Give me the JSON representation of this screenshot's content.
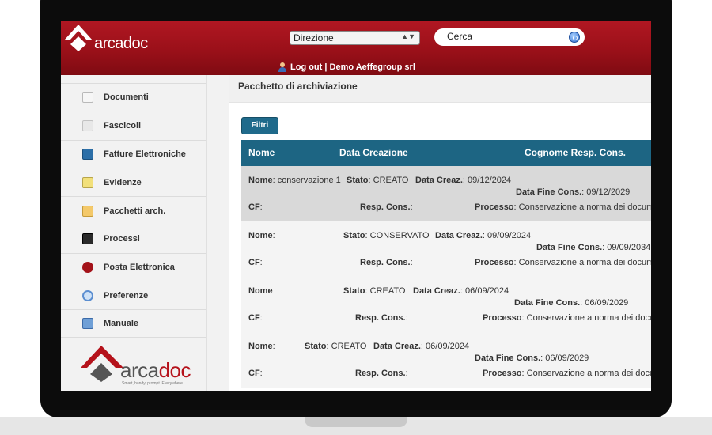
{
  "header": {
    "logo_text": "arcadoc",
    "selector_value": "Direzione",
    "search_value": "Cerca",
    "logout_text": "Log out | Demo Aeffegroup srl"
  },
  "sidebar": {
    "items": [
      {
        "label": "Documenti",
        "icon": "document-icon"
      },
      {
        "label": "Fascicoli",
        "icon": "folders-icon"
      },
      {
        "label": "Fatture Elettroniche",
        "icon": "invoice-icon"
      },
      {
        "label": "Evidenze",
        "icon": "highlight-icon"
      },
      {
        "label": "Pacchetti arch.",
        "icon": "package-icon"
      },
      {
        "label": "Processi",
        "icon": "process-icon"
      },
      {
        "label": "Posta Elettronica",
        "icon": "mail-icon"
      },
      {
        "label": "Preferenze",
        "icon": "preferences-icon"
      },
      {
        "label": "Manuale",
        "icon": "manual-icon"
      }
    ],
    "logo_text_gray": "arca",
    "logo_text_red": "doc",
    "tagline": "Smart, handy, prompt. Everywhere"
  },
  "main": {
    "page_title": "Pacchetto di archiviazione",
    "filter_button": "Filtri",
    "columns": [
      "Nome",
      "Data Creazione",
      "Cognome Resp. Cons."
    ],
    "labels": {
      "nome": "Nome",
      "stato": "Stato",
      "data_creaz": "Data Creaz.",
      "data_fine": "Data Fine Cons.",
      "cf": "CF",
      "resp": "Resp. Cons.",
      "processo": "Processo"
    },
    "rows": [
      {
        "nome": "conservazione 1",
        "stato": "CREATO",
        "data_creaz": "09/12/2024",
        "data_fine": "09/12/2029",
        "cf": "",
        "resp": "",
        "processo": "Conservazione a norma dei documer"
      },
      {
        "nome": "",
        "stato": "CONSERVATO",
        "data_creaz": "09/09/2024",
        "data_fine": "09/09/2034",
        "cf": "",
        "resp": "",
        "processo": "Conservazione a norma dei documer"
      },
      {
        "nome": "",
        "stato": "CREATO",
        "data_creaz": "06/09/2024",
        "data_fine": "06/09/2029",
        "cf": "",
        "resp": "",
        "processo": "Conservazione a norma dei docur"
      },
      {
        "nome": "",
        "stato": "CREATO",
        "data_creaz": "06/09/2024",
        "data_fine": "06/09/2029",
        "cf": "",
        "resp": "",
        "processo": "Conservazione a norma dei docum"
      }
    ]
  },
  "colors": {
    "header_red": "#9a1019",
    "table_header_teal": "#1d6583",
    "filter_button": "#1f6a8b"
  }
}
